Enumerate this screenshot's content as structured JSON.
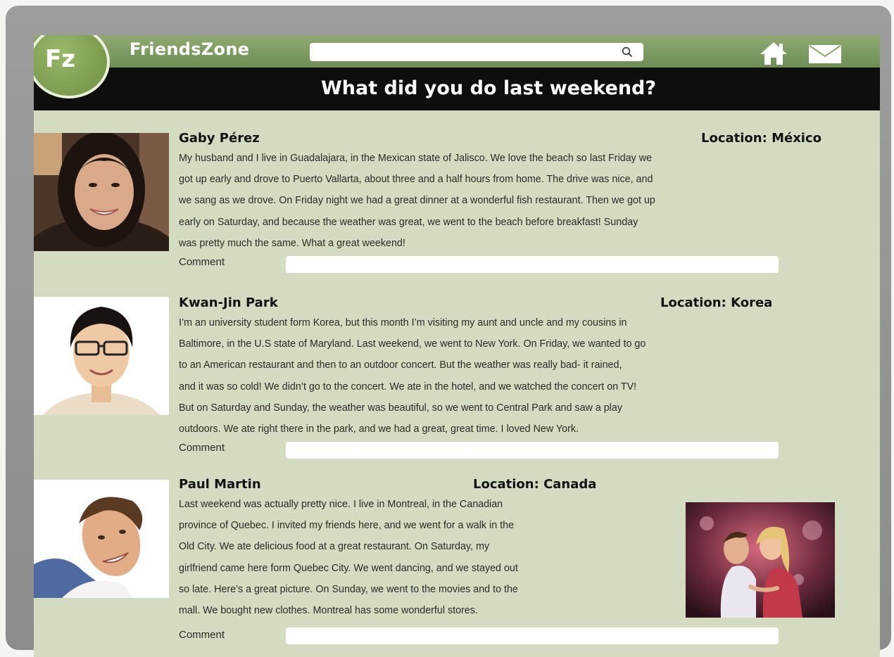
{
  "app": {
    "logo": "Fz",
    "name": "FriendsZone",
    "search": {
      "placeholder": ""
    },
    "icons": [
      "search-icon",
      "home-icon",
      "mail-icon"
    ]
  },
  "page": {
    "title": "What did you do last weekend?"
  },
  "colors": {
    "brand_green": "#7c9a4e",
    "title_bar": "#0d0f0c",
    "content_bg": "#d3dcc0",
    "frame": "#8c8c8c"
  },
  "posts": [
    {
      "name": "Gaby Pérez",
      "location": "Location: México",
      "lines": [
        "My husband and I live in Guadalajara, in the Mexican state of Jalisco. We love the beach so last Friday we",
        "got up early and drove to Puerto Vallarta, about three and a half hours from home. The drive was nice, and",
        "we sang as we drove. On Friday night we had a great dinner at a wonderful fish restaurant. Then we got up",
        "early on Saturday, and because the weather was great, we went to the beach before breakfast! Sunday",
        "was pretty much the same. What a great weekend!"
      ],
      "comment_label": "Comment"
    },
    {
      "name": "Kwan-Jin Park",
      "location": "Location: Korea",
      "lines": [
        "I’m an university student form Korea, but this month I’m visiting my aunt and uncle and my cousins in",
        "Baltimore, in the U.S state of Maryland. Last weekend, we went to New York. On Friday, we wanted to go",
        "to an American restaurant and then to an outdoor concert. But the weather was really bad- it rained,",
        "and it was so cold! We didn’t go to the concert. We ate in the hotel, and we watched the concert on TV!",
        "But on Saturday and Sunday, the weather was beautiful, so we went to Central Park and saw a play",
        "outdoors. We ate right there in the park, and we had a great, great time. I loved New York."
      ],
      "comment_label": "Comment"
    },
    {
      "name": "Paul Martin",
      "location": "Location: Canada",
      "lines": [
        "Last weekend was actually pretty nice. I live in Montreal, in the Canadian",
        "province of Quebec. I invited my friends here, and we went for a walk in the",
        "Old City. We ate delicious food at a great restaurant. On Saturday, my",
        "girlfriend came here form Quebec City. We went dancing, and we stayed out",
        "so late. Here’s a great picture. On Sunday, we went to the movies and to the",
        "mall. We bought new clothes. Montreal has some wonderful stores."
      ],
      "comment_label": "Comment"
    }
  ]
}
